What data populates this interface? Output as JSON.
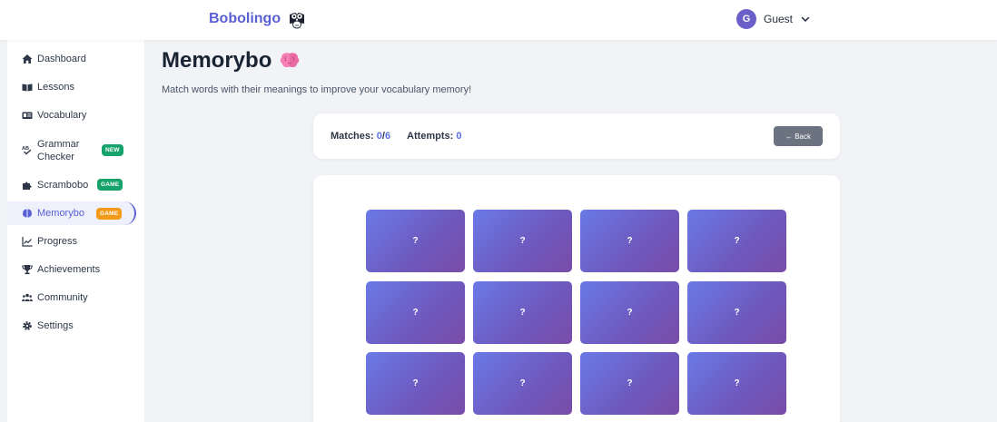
{
  "header": {
    "brand": "Bobolingo",
    "user": {
      "initial": "G",
      "name": "Guest"
    }
  },
  "sidebar": {
    "items": [
      {
        "label": "Dashboard",
        "icon": "home-icon"
      },
      {
        "label": "Lessons",
        "icon": "book-icon"
      },
      {
        "label": "Vocabulary",
        "icon": "vocabulary-card-icon"
      },
      {
        "label": "Grammar Checker",
        "line1": "Grammar",
        "line2": "Checker",
        "icon": "spellcheck-icon",
        "badge": "NEW"
      },
      {
        "label": "Scrambobo",
        "icon": "puzzle-icon",
        "badge": "GAME"
      },
      {
        "label": "Memorybo",
        "icon": "brain-icon",
        "badge": "GAME",
        "active": true
      },
      {
        "label": "Progress",
        "icon": "chart-line-icon"
      },
      {
        "label": "Achievements",
        "icon": "trophy-icon"
      },
      {
        "label": "Community",
        "icon": "users-icon"
      },
      {
        "label": "Settings",
        "icon": "gear-icon"
      }
    ]
  },
  "main": {
    "title": "Memorybo",
    "subtitle": "Match words with their meanings to improve your vocabulary memory!",
    "stats": {
      "matches_label": "Matches:",
      "matches": "0",
      "matches_sep": "/",
      "matches_total": "6",
      "attempts_label": "Attempts:",
      "attempts": "0"
    },
    "back_label": "← Back",
    "cards": [
      "?",
      "?",
      "?",
      "?",
      "?",
      "?",
      "?",
      "?",
      "?",
      "?",
      "?",
      "?"
    ]
  },
  "colors": {
    "brand": "#5a5fd6",
    "badge_new": "#16a36a",
    "badge_game": "#f39a18",
    "card_gradient_start": "#6a7ae6",
    "card_gradient_end": "#7a4ca8",
    "back_button": "#6b7280"
  }
}
